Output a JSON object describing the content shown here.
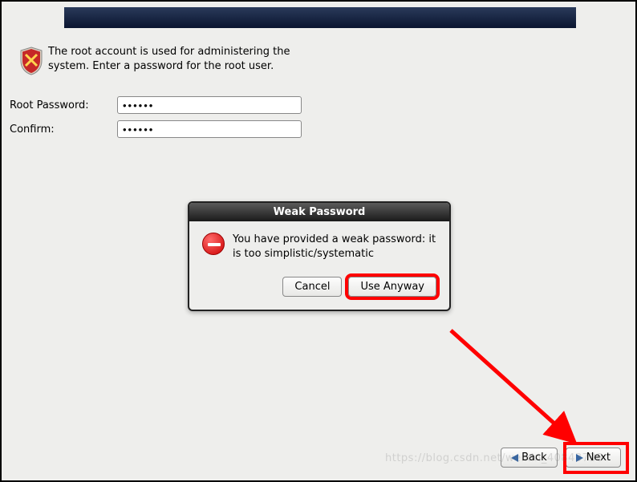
{
  "description": "The root account is used for administering the system.  Enter a password for the root user.",
  "form": {
    "root_password_label": "Root Password:",
    "root_password_value": "••••••",
    "confirm_label": "Confirm:",
    "confirm_value": "••••••"
  },
  "dialog": {
    "title": "Weak Password",
    "message": "You have provided a weak password: it is too simplistic/systematic",
    "cancel": "Cancel",
    "use_anyway": "Use Anyway"
  },
  "nav": {
    "back": "Back",
    "next": "Next"
  },
  "watermark": "https://blog.csdn.net/weixin_40843738"
}
